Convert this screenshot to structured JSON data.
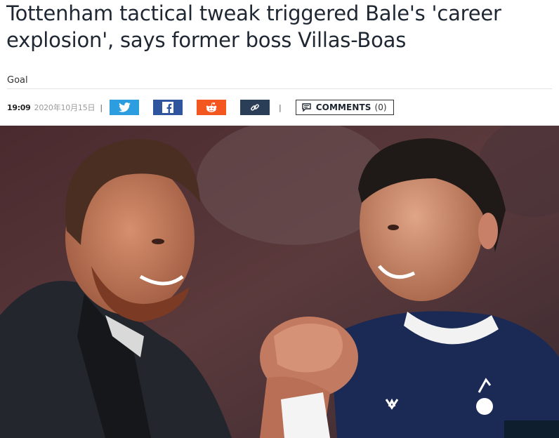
{
  "article": {
    "headline": "Tottenham tactical tweak triggered Bale's 'career explosion', says former boss Villas-Boas",
    "source": "Goal",
    "time": "19:09",
    "date": "2020年10月15日",
    "separator": "|"
  },
  "share": {
    "twitter": "twitter-icon",
    "facebook": "facebook-icon",
    "reddit": "reddit-icon",
    "link": "link-icon"
  },
  "comments": {
    "label": "COMMENTS",
    "count": "(0)"
  },
  "colors": {
    "twitter": "#2c9ee0",
    "facebook": "#2f559e",
    "reddit": "#f3561f",
    "link": "#2a3e57",
    "headline": "#1f2733",
    "kit_navy": "#1b2a55"
  }
}
